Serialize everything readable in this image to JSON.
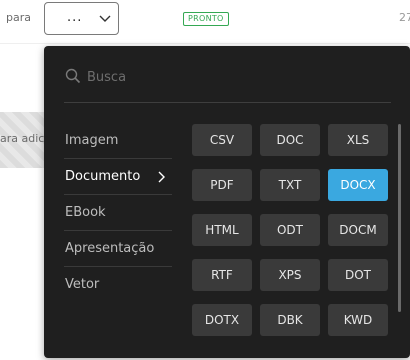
{
  "topbar": {
    "para_label": "para",
    "select_value": "...",
    "status_badge": "PRONTO",
    "right_text": "27"
  },
  "background": {
    "strip_text": "ara adici"
  },
  "search": {
    "placeholder": "Busca",
    "value": ""
  },
  "categories": [
    {
      "label": "Imagem"
    },
    {
      "label": "Documento"
    },
    {
      "label": "EBook"
    },
    {
      "label": "Apresentação"
    },
    {
      "label": "Vetor"
    }
  ],
  "active_category": "Documento",
  "formats": [
    "CSV",
    "DOC",
    "XLS",
    "PDF",
    "TXT",
    "DOCX",
    "HTML",
    "ODT",
    "DOCM",
    "RTF",
    "XPS",
    "DOT",
    "DOTX",
    "DBK",
    "KWD"
  ],
  "selected_format": "DOCX",
  "colors": {
    "panel_bg": "#1f1f1f",
    "button_bg": "#3a3a3a",
    "accent": "#3aa8e0",
    "status_green": "#34a853"
  },
  "icons": {
    "search": "search-icon",
    "select_chevron": "chevron-down-icon",
    "category_chevron": "chevron-right-icon"
  }
}
